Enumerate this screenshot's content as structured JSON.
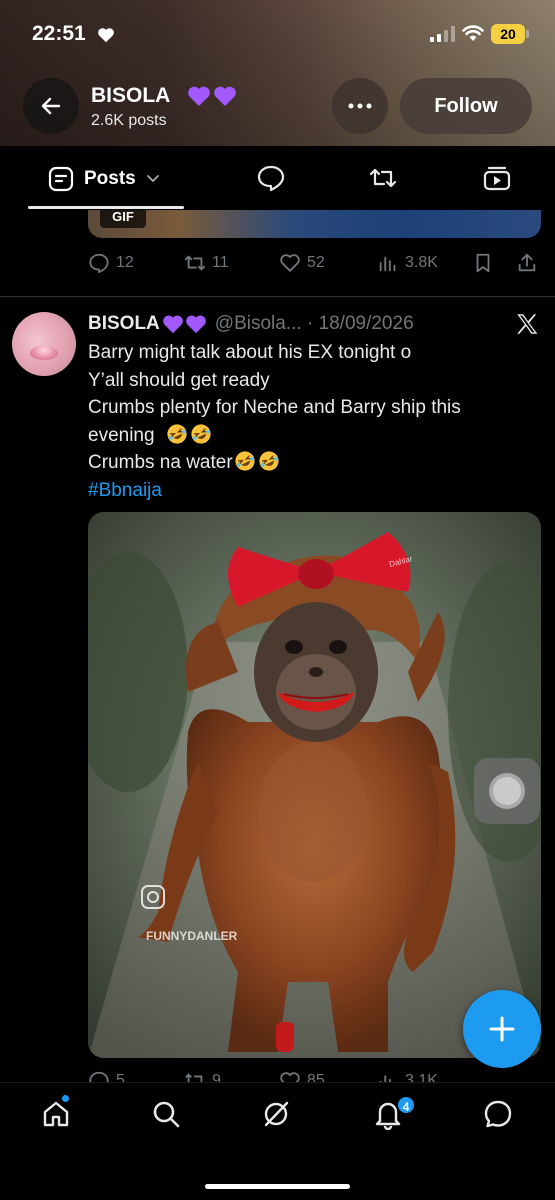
{
  "status_bar": {
    "time": "22:51",
    "battery": "20"
  },
  "profile": {
    "name": "BISOLA",
    "posts_count": "2.6K posts",
    "follow_label": "Follow"
  },
  "tabs": {
    "active_label": "Posts"
  },
  "prev_tweet": {
    "media_badge": "GIF",
    "replies": "12",
    "reposts": "11",
    "likes": "52",
    "views": "3.8K"
  },
  "tweet": {
    "author_name": "BISOLA",
    "handle_date": "@Bisola... · 18/09/2026",
    "lines": [
      "Barry might talk about his EX tonight o",
      "Y’all should get ready",
      "Crumbs  plenty for Neche and Barry ship this",
      "evening",
      "Crumbs na water"
    ],
    "hashtag": "#Bbnaija",
    "media_watermark": "FUNNYDANLER",
    "bow_text": "Dahlar",
    "replies": "5",
    "reposts": "9",
    "likes": "85",
    "views": "3.1K"
  },
  "bottom_nav": {
    "notifications_count": "4"
  },
  "colors": {
    "accent": "#1d9bf0",
    "muted": "#71767b",
    "text": "#e7e9ea",
    "heart_purple": "#a259ff"
  }
}
